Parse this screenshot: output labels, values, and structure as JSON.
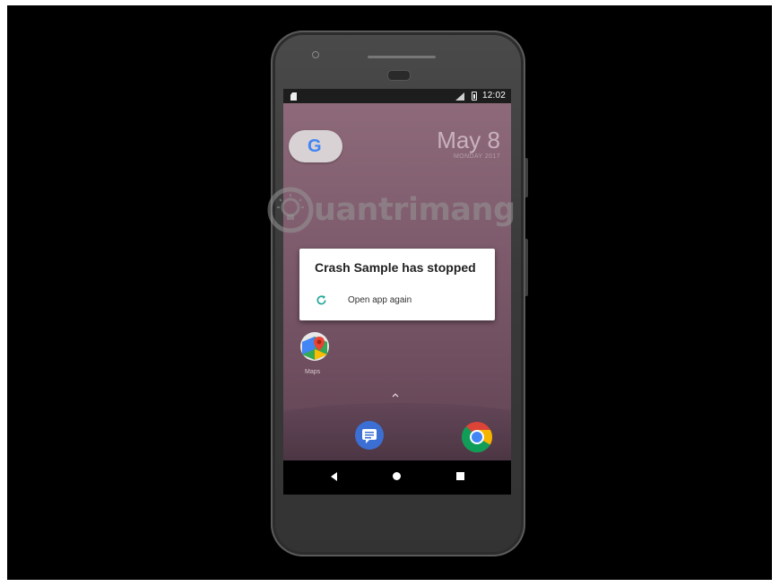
{
  "status_bar": {
    "time": "12:02",
    "icons": [
      "sim-icon",
      "signal-icon",
      "battery-icon"
    ]
  },
  "home": {
    "search_widget_letter": "G",
    "date": "May 8",
    "date_sub": "MONDAY 2017",
    "apps": [
      {
        "label": "Maps",
        "icon": "maps-icon"
      }
    ],
    "dock": [
      {
        "icon": "messages-icon"
      },
      {
        "icon": "chrome-icon"
      }
    ]
  },
  "dialog": {
    "title": "Crash Sample has stopped",
    "action_label": "Open app again",
    "action_icon": "refresh-icon",
    "accent_color": "#26a69a"
  },
  "nav_bar": {
    "buttons": [
      "back-icon",
      "home-icon",
      "recents-icon"
    ]
  },
  "watermark": {
    "text": "uantrimang"
  }
}
